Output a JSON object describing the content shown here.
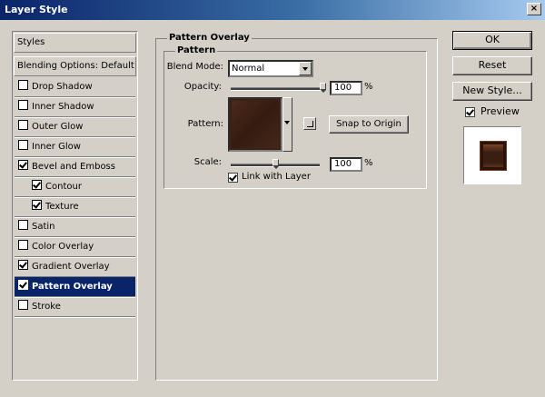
{
  "window": {
    "title": "Layer Style",
    "close_symbol": "×"
  },
  "styles_panel": {
    "header": "Styles",
    "blending": "Blending Options: Default",
    "items": [
      {
        "label": "Drop Shadow",
        "checked": false,
        "sub": false,
        "selected": false
      },
      {
        "label": "Inner Shadow",
        "checked": false,
        "sub": false,
        "selected": false
      },
      {
        "label": "Outer Glow",
        "checked": false,
        "sub": false,
        "selected": false
      },
      {
        "label": "Inner Glow",
        "checked": false,
        "sub": false,
        "selected": false
      },
      {
        "label": "Bevel and Emboss",
        "checked": true,
        "sub": false,
        "selected": false
      },
      {
        "label": "Contour",
        "checked": true,
        "sub": true,
        "selected": false
      },
      {
        "label": "Texture",
        "checked": true,
        "sub": true,
        "selected": false
      },
      {
        "label": "Satin",
        "checked": false,
        "sub": false,
        "selected": false
      },
      {
        "label": "Color Overlay",
        "checked": false,
        "sub": false,
        "selected": false
      },
      {
        "label": "Gradient Overlay",
        "checked": true,
        "sub": false,
        "selected": false
      },
      {
        "label": "Pattern Overlay",
        "checked": true,
        "sub": false,
        "selected": true
      },
      {
        "label": "Stroke",
        "checked": false,
        "sub": false,
        "selected": false
      }
    ]
  },
  "pattern_overlay": {
    "group_title": "Pattern Overlay",
    "sub_title": "Pattern",
    "blend_mode_label": "Blend Mode:",
    "blend_mode_value": "Normal",
    "opacity_label": "Opacity:",
    "opacity_value": "100",
    "opacity_fraction": 1.0,
    "percent": "%",
    "pattern_label": "Pattern:",
    "snap_button": "Snap to Origin",
    "scale_label": "Scale:",
    "scale_value": "100",
    "scale_slider_fraction": 0.5,
    "link_label": "Link with Layer",
    "link_checked": true
  },
  "actions": {
    "ok": "OK",
    "reset": "Reset",
    "new_style": "New Style...",
    "preview_label": "Preview",
    "preview_checked": true
  },
  "colors": {
    "title_gradient_start": "#0a246a",
    "selection": "#0a246a",
    "pattern_brown": "#3c2014"
  }
}
